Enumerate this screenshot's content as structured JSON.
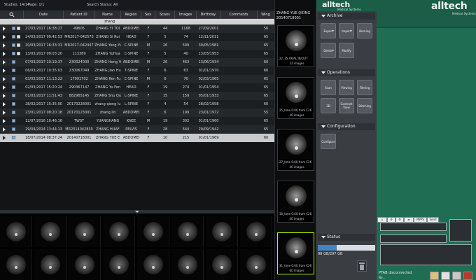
{
  "study_list": {
    "info": {
      "studies": "Studies: 14/14",
      "page": "Page: 1/1",
      "search_status": "Search Status: All"
    },
    "columns": [
      "Date",
      "Patient ID",
      "Name",
      "Region",
      "Sex",
      "Scans",
      "Images",
      "Birthday",
      "Comments",
      "Wing"
    ],
    "filter_value": "zhang",
    "rows": [
      [
        "27/03/2017 16:38:27",
        "49605",
        "ZHANG YI TOI",
        "ABDOMEI",
        "F",
        "44",
        "1168",
        "27/09/2001",
        "",
        "56"
      ],
      [
        "24/03/2017 09:42:53",
        "MR2017-042570",
        "ZHANG Si Rui",
        "HEAD",
        "F",
        "5",
        "74",
        "12/11/2011",
        "",
        "65"
      ],
      [
        "20/03/2017 16:33:31",
        "MR2017-042447",
        "ZHANG Yong Yu",
        "C-SPINE",
        "M",
        "26",
        "509",
        "30/05/1981",
        "",
        "65"
      ],
      [
        "13/03/2017 09:03:20",
        "113389",
        "ZHANG YuHua",
        "C-SPINE",
        "F",
        "5",
        "40",
        "13/03/1953",
        "",
        "65"
      ],
      [
        "07/03/2017 10:19:37",
        "230024000",
        "ZHANG Hong Yu",
        "ABDOMEI",
        "M",
        "26",
        "463",
        "13/06/1934",
        "",
        "60"
      ],
      [
        "06/03/2017 10:35:03",
        "230067049",
        "ZHANG Jian Hu",
        "T-SPINE",
        "F",
        "6",
        "63",
        "01/01/1970",
        "",
        "60"
      ],
      [
        "03/03/2017 11:13:22",
        "17091702",
        "ZHANG Ren Fu",
        "C-SPINE",
        "M",
        "6",
        "70",
        "02/03/1965",
        "",
        "65"
      ],
      [
        "02/03/2017 15:20:24",
        "290367147",
        "ZHANG Yu Fen",
        "HEAD",
        "F",
        "19",
        "274",
        "01/01/1954",
        "",
        "65"
      ],
      [
        "01/03/2017 11:51:43",
        "882965145",
        "ZHANG Shu Qu",
        "L-SPINE",
        "F",
        "15",
        "159",
        "05/01/1933",
        "",
        "65"
      ],
      [
        "28/02/2017 15:35:00",
        "20170228001",
        "zhang qiong lu",
        "L-SPINE",
        "F",
        "4",
        "54",
        "28/02/1958",
        "",
        "60"
      ],
      [
        "23/01/2017 08:20:18",
        "20170123001",
        "zhang lin",
        "ABDOMEI",
        "F",
        "6",
        "199",
        "23/01/1972",
        "",
        "55"
      ],
      [
        "12/07/2016 10:46:16",
        "TWST",
        "YUANGHANG",
        "KNEE",
        "M",
        "19",
        "302",
        "01/01/1960",
        "",
        "65"
      ],
      [
        "29/04/2014 13:44:13",
        "MR2014042830",
        "ZHANG HUAF",
        "PELVIS",
        "F",
        "28",
        "544",
        "29/09/1942",
        "",
        "65"
      ],
      [
        "18/07/2014 08:37:24",
        "20140718001",
        "ZHANG YUE E",
        "ABDOMEI",
        "F",
        "10",
        "215",
        "01/01/1969",
        "",
        "60"
      ]
    ],
    "selected_row": 13
  },
  "series": {
    "patient_name": "ZHANG YUE QIONG",
    "patient_id": "20140718001",
    "items": [
      {
        "title": "22_15 AXIAL IN/OUT",
        "count": "32 images"
      },
      {
        "title": "25_time 0:00 from C26",
        "count": "40 images"
      },
      {
        "title": "27_time 0:00 from C26",
        "count": "40 images"
      },
      {
        "title": "30_time 0:00 from C26",
        "count": "40 images"
      },
      {
        "title": "31_time 0:00 from C26",
        "count": "60 images"
      }
    ],
    "selected_index": 4
  },
  "panel": {
    "brand": "alltech",
    "brand_sub": "Medical Systems",
    "archive": {
      "title": "Archive",
      "buttons": [
        "Export",
        "Import",
        "Burning",
        "Delete",
        "Modify"
      ]
    },
    "operations": {
      "title": "Operations",
      "buttons": [
        "Scan",
        "Viewing",
        "Filming",
        "3D",
        "Contrast View",
        "Stitching"
      ]
    },
    "configuration": {
      "title": "Configuration",
      "buttons": [
        "Configure"
      ]
    },
    "status": {
      "title": "Status",
      "disk": "98 GB/297 GB",
      "used_fraction": 0.33
    }
  },
  "green_panel": {
    "brand": "alltech",
    "brand_sub": "Medical Systems",
    "tabs": [
      "MPPS",
      "Send"
    ],
    "ptab_status": "PTAB disconnected",
    "ptab_msg": "No..."
  },
  "colors": {
    "brand_green": "#1b5d47",
    "selection_highlight": "#b6ff00",
    "status_fill": "#3e86c4"
  }
}
